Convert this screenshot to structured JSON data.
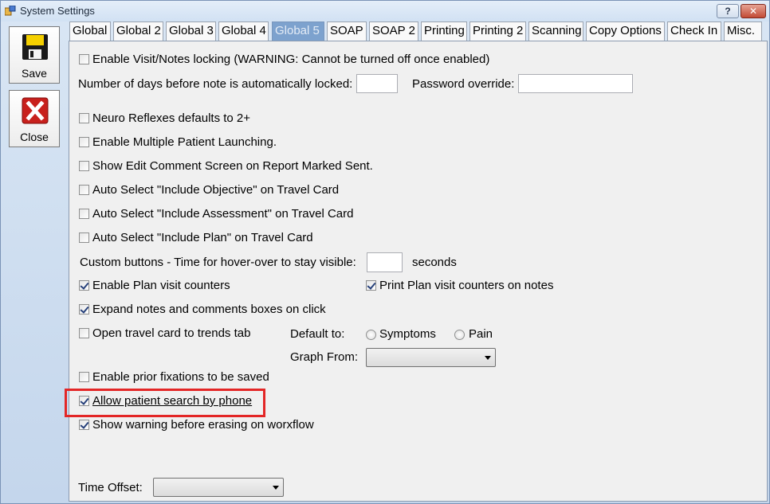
{
  "window": {
    "title": "System Settings",
    "help_label": "?",
    "close_label": "✕"
  },
  "sidebar": {
    "save_label": "Save",
    "close_label": "Close"
  },
  "tabs": [
    {
      "label": "Global"
    },
    {
      "label": "Global 2"
    },
    {
      "label": "Global 3"
    },
    {
      "label": "Global 4"
    },
    {
      "label": "Global 5"
    },
    {
      "label": "SOAP"
    },
    {
      "label": "SOAP 2"
    },
    {
      "label": "Printing"
    },
    {
      "label": "Printing 2"
    },
    {
      "label": "Scanning"
    },
    {
      "label": "Copy Options"
    },
    {
      "label": "Check In"
    },
    {
      "label": "Misc."
    }
  ],
  "active_tab": "Global 5",
  "settings": {
    "visit_locking": {
      "label": "Enable Visit/Notes locking (WARNING: Cannot be turned off once enabled)",
      "checked": false
    },
    "days_before_lock": {
      "label": "Number of days before note is automatically locked:",
      "value": ""
    },
    "password_override": {
      "label": "Password override:",
      "value": ""
    },
    "neuro_reflexes": {
      "label": "Neuro Reflexes defaults to 2+",
      "checked": false
    },
    "multi_patient": {
      "label": "Enable Multiple Patient Launching.",
      "checked": false
    },
    "edit_comment": {
      "label": "Show Edit Comment Screen on Report Marked Sent.",
      "checked": false
    },
    "include_objective": {
      "label": "Auto Select \"Include Objective\" on Travel Card",
      "checked": false
    },
    "include_assessment": {
      "label": "Auto Select \"Include Assessment\" on Travel Card",
      "checked": false
    },
    "include_plan": {
      "label": "Auto Select \"Include Plan\" on Travel Card",
      "checked": false
    },
    "custom_buttons": {
      "label": "Custom buttons  - Time for hover-over to stay visible:",
      "value": "",
      "unit": "seconds"
    },
    "plan_counters": {
      "label": "Enable Plan visit counters",
      "checked": true
    },
    "print_plan_counters": {
      "label": "Print Plan visit counters on notes",
      "checked": true
    },
    "expand_notes": {
      "label": "Expand notes and comments boxes on click",
      "checked": true
    },
    "travel_trends": {
      "label": "Open travel card to trends tab",
      "checked": false
    },
    "default_to": {
      "label": "Default to:",
      "options": [
        "Symptoms",
        "Pain"
      ],
      "selected": ""
    },
    "graph_from": {
      "label": "Graph From:",
      "value": ""
    },
    "prior_fixations": {
      "label": "Enable prior fixations to be saved",
      "checked": false
    },
    "search_by_phone": {
      "label": "Allow patient search by phone",
      "checked": true
    },
    "erase_warning": {
      "label": "Show warning before erasing on worxflow",
      "checked": true
    },
    "time_offset": {
      "label": "Time Offset:",
      "value": ""
    }
  },
  "colors": {
    "highlight": "#e32626",
    "active_tab": "#7da2ce"
  }
}
